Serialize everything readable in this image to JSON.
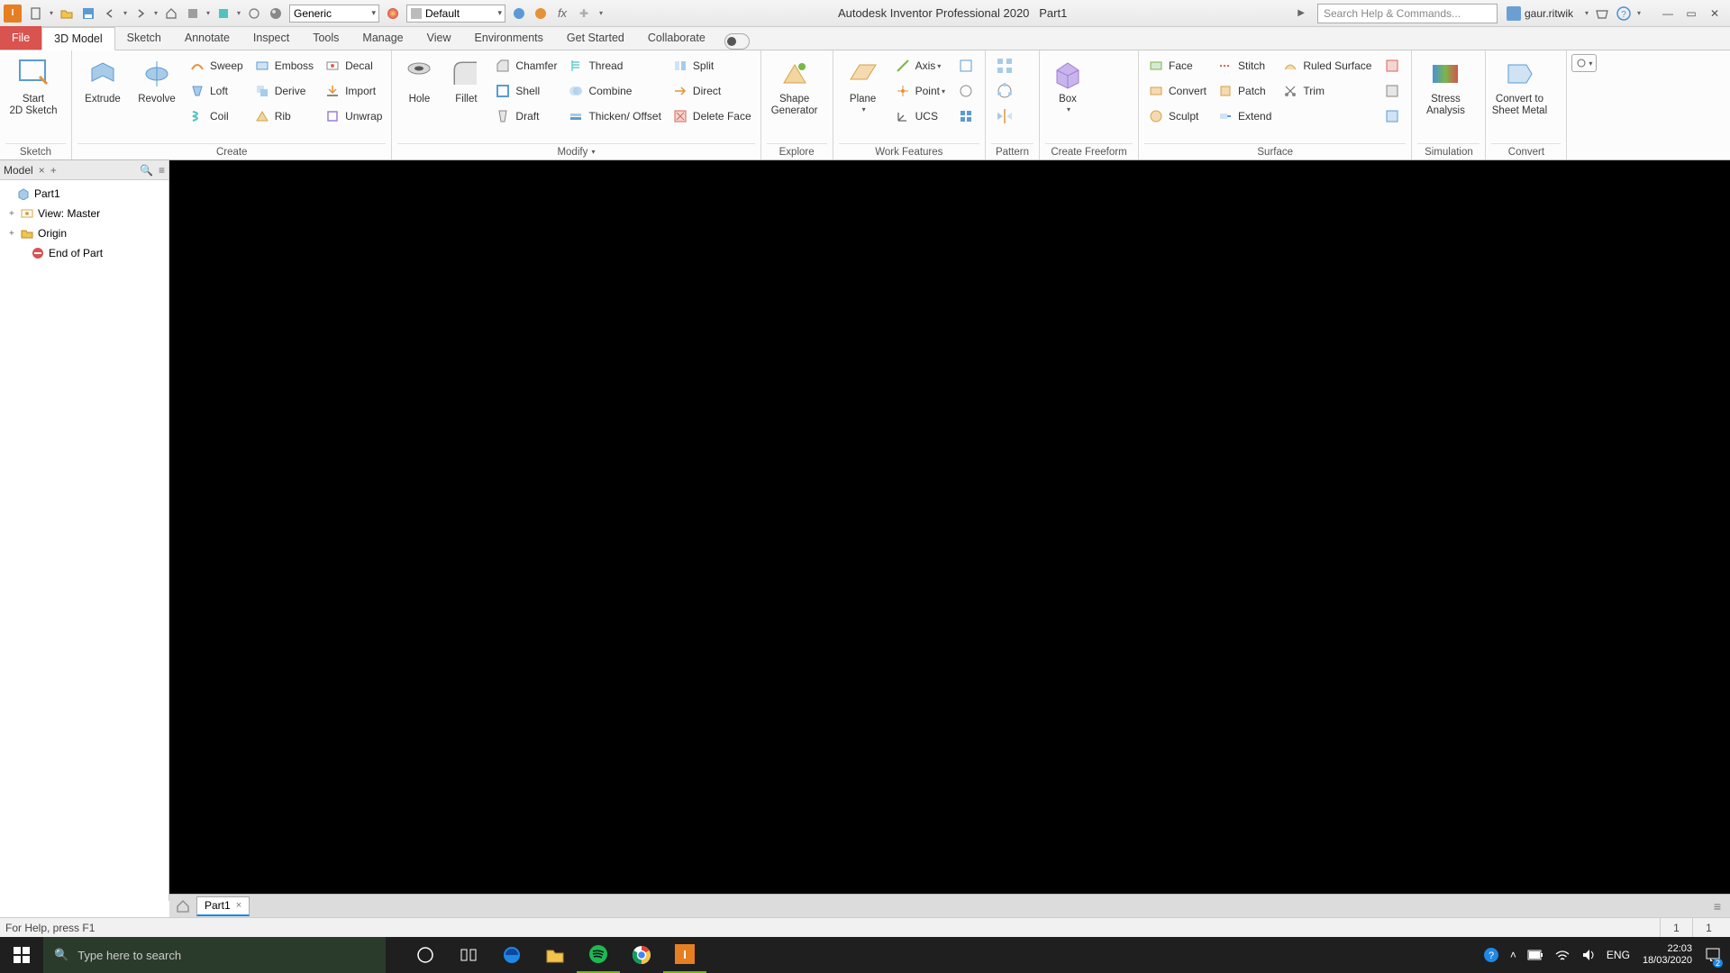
{
  "qat": {
    "material_combo": "Generic",
    "appearance_combo": "Default",
    "title": "Autodesk Inventor Professional 2020",
    "doc": "Part1",
    "search_placeholder": "Search Help & Commands...",
    "user": "gaur.ritwik"
  },
  "tabs": {
    "file": "File",
    "items": [
      "3D Model",
      "Sketch",
      "Annotate",
      "Inspect",
      "Tools",
      "Manage",
      "View",
      "Environments",
      "Get Started",
      "Collaborate"
    ],
    "active": 0
  },
  "ribbon": {
    "sketch": {
      "title": "Sketch",
      "start": "Start\n2D Sketch"
    },
    "create": {
      "title": "Create",
      "extrude": "Extrude",
      "revolve": "Revolve",
      "sweep": "Sweep",
      "emboss": "Emboss",
      "decal": "Decal",
      "loft": "Loft",
      "derive": "Derive",
      "import": "Import",
      "coil": "Coil",
      "rib": "Rib",
      "unwrap": "Unwrap"
    },
    "modify": {
      "title": "Modify",
      "hole": "Hole",
      "fillet": "Fillet",
      "chamfer": "Chamfer",
      "thread": "Thread",
      "split": "Split",
      "shell": "Shell",
      "combine": "Combine",
      "direct": "Direct",
      "draft": "Draft",
      "thicken": "Thicken/ Offset",
      "deleteface": "Delete Face"
    },
    "explore": {
      "title": "Explore",
      "shape": "Shape\nGenerator"
    },
    "work": {
      "title": "Work Features",
      "plane": "Plane",
      "axis": "Axis",
      "point": "Point",
      "ucs": "UCS"
    },
    "pattern": {
      "title": "Pattern"
    },
    "freeform": {
      "title": "Create Freeform",
      "box": "Box"
    },
    "surface": {
      "title": "Surface",
      "face": "Face",
      "stitch": "Stitch",
      "ruled": "Ruled Surface",
      "convert": "Convert",
      "patch": "Patch",
      "trim": "Trim",
      "sculpt": "Sculpt",
      "extend": "Extend"
    },
    "simulation": {
      "title": "Simulation",
      "stress": "Stress\nAnalysis"
    },
    "convert": {
      "title": "Convert",
      "sheet": "Convert to\nSheet Metal"
    }
  },
  "browser": {
    "tab": "Model",
    "nodes": {
      "root": "Part1",
      "view": "View: Master",
      "origin": "Origin",
      "end": "End of Part"
    }
  },
  "doctab": {
    "name": "Part1"
  },
  "status": {
    "help": "For Help, press F1",
    "a": "1",
    "b": "1"
  },
  "taskbar": {
    "search_placeholder": "Type here to search",
    "lang": "ENG",
    "time": "22:03",
    "date": "18/03/2020",
    "notif": "2"
  }
}
